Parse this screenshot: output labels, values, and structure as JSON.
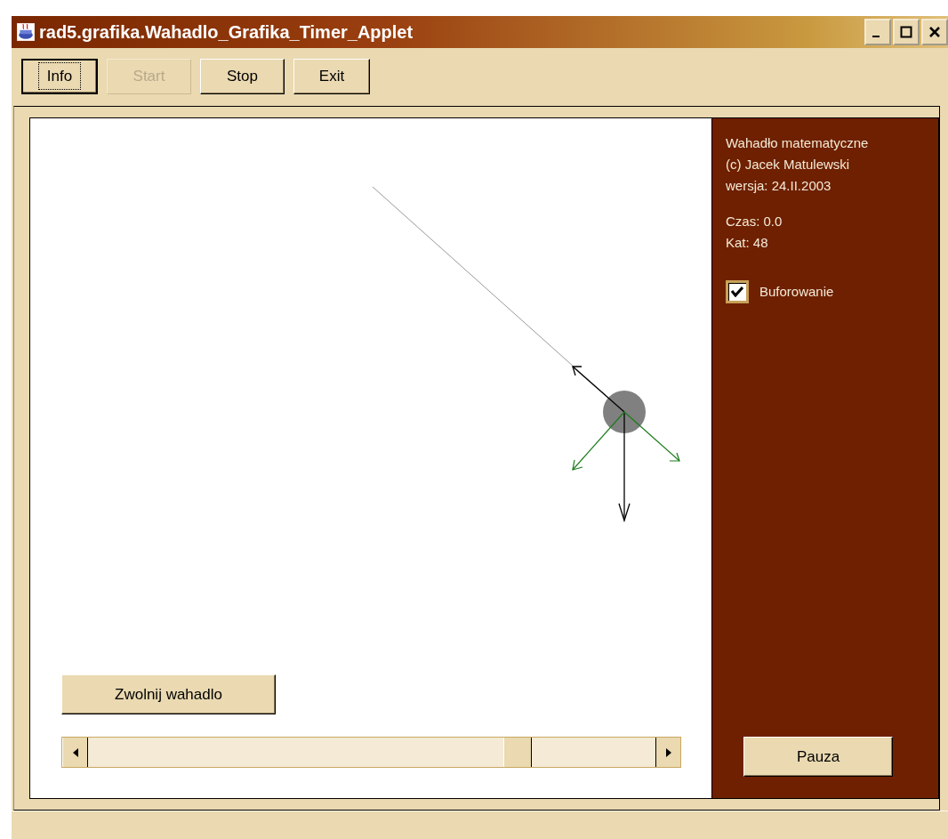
{
  "window": {
    "title": "rad5.grafika.Wahadlo_Grafika_Timer_Applet"
  },
  "toolbar": [
    {
      "label": "Info",
      "disabled": false,
      "focused": true
    },
    {
      "label": "Start",
      "disabled": true,
      "focused": false
    },
    {
      "label": "Stop",
      "disabled": false,
      "focused": false
    },
    {
      "label": "Exit",
      "disabled": false,
      "focused": false
    }
  ],
  "canvas": {
    "release_button": "Zwolnij wahadlo",
    "slider": {
      "level": 0.77
    }
  },
  "info_panel": {
    "lines": [
      "Wahadło matematyczne",
      "(c) Jacek Matulewski",
      "wersja: 24.II.2003"
    ],
    "readings": [
      "Czas: 0.0",
      "Kat: 48"
    ],
    "checkbox": {
      "label": "Buforowanie",
      "checked": true
    },
    "pause_button": "Pauza"
  }
}
